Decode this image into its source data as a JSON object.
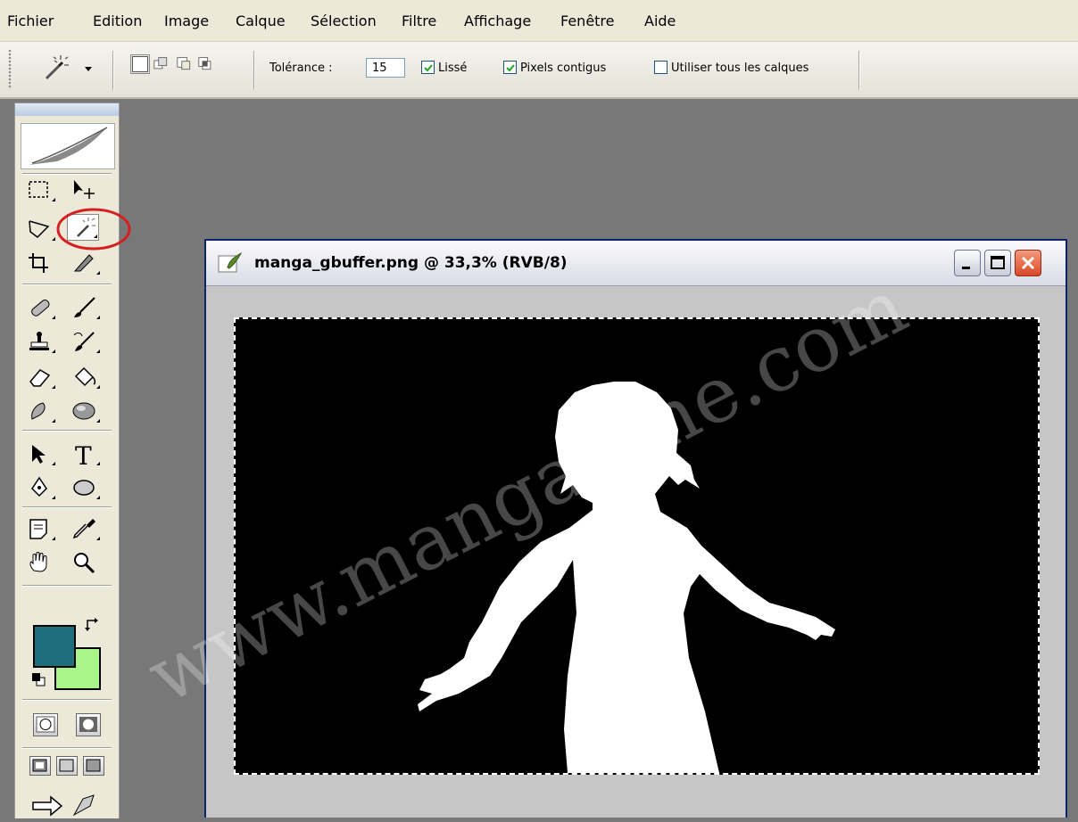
{
  "menubar": {
    "items": [
      "Fichier",
      "Edition",
      "Image",
      "Calque",
      "Sélection",
      "Filtre",
      "Affichage",
      "Fenêtre",
      "Aide"
    ]
  },
  "options": {
    "tolerance_label": "Tolérance :",
    "tolerance_value": "15",
    "antialias_label": "Lissé",
    "antialias_checked": true,
    "contiguous_label": "Pixels contigus",
    "contiguous_checked": true,
    "sample_all_label": "Utiliser tous les calques",
    "sample_all_checked": false
  },
  "toolbox": {
    "selected_tool": "magic-wand-icon",
    "foreground_color": "#1f6e7e",
    "background_color": "#a8f58a"
  },
  "document": {
    "title": "manga_gbuffer.png @ 33,3% (RVB/8)",
    "canvas_background": "#000000",
    "silhouette_color": "#ffffff"
  },
  "watermark": {
    "text": "www.manga-tine.com"
  }
}
